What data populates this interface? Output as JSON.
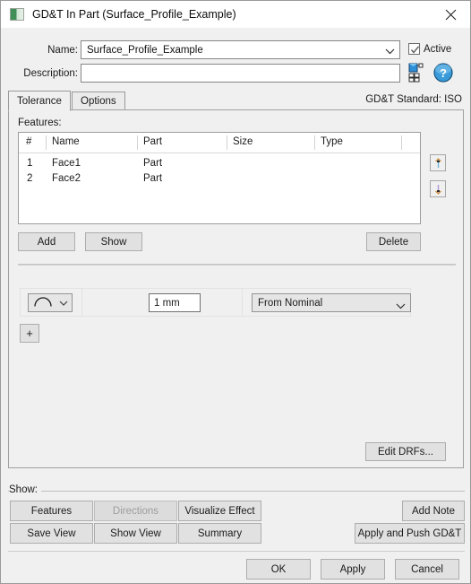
{
  "window": {
    "title": "GD&T In Part (Surface_Profile_Example)",
    "icon": "app-icon",
    "close_icon": "close-icon"
  },
  "form": {
    "name_label": "Name:",
    "name_value": "Surface_Profile_Example",
    "description_label": "Description:",
    "description_value": "",
    "description_placeholder": "",
    "active_label": "Active",
    "active_checked": true,
    "attributes_icon": "attributes-icon",
    "help_icon": "help-icon"
  },
  "tabs": {
    "items": [
      {
        "label": "Tolerance",
        "active": true
      },
      {
        "label": "Options",
        "active": false
      }
    ],
    "standard_label": "GD&T Standard: ISO"
  },
  "features": {
    "section_label": "Features:",
    "columns": [
      "#",
      "Name",
      "Part",
      "Size",
      "Type"
    ],
    "rows": [
      {
        "index": "1",
        "name": "Face1",
        "part": "Part",
        "size": "",
        "type": ""
      },
      {
        "index": "2",
        "name": "Face2",
        "part": "Part",
        "size": "",
        "type": ""
      }
    ],
    "move_up_icon": "arrow-up-icon",
    "move_down_icon": "arrow-down-icon",
    "add_label": "Add",
    "show_label": "Show",
    "delete_label": "Delete"
  },
  "tolerance_row": {
    "symbol_icon": "surface-profile-symbol",
    "symbol_dropdown_icon": "chevron-down-icon",
    "value": "1 mm",
    "mode": "From Nominal",
    "mode_dropdown_icon": "chevron-down-icon",
    "add_row_label": "+",
    "edit_drfs_label": "Edit DRFs..."
  },
  "show_group": {
    "label": "Show:",
    "buttons": [
      {
        "label": "Features",
        "disabled": false
      },
      {
        "label": "Directions",
        "disabled": true
      },
      {
        "label": "Visualize Effect",
        "disabled": false
      },
      {
        "label": "Add Note",
        "disabled": false
      },
      {
        "label": "Save View",
        "disabled": false
      },
      {
        "label": "Show View",
        "disabled": false
      },
      {
        "label": "Summary",
        "disabled": false
      },
      {
        "label": "Apply and Push GD&T",
        "disabled": false
      }
    ]
  },
  "dialog_buttons": {
    "ok": "OK",
    "apply": "Apply",
    "cancel": "Cancel"
  },
  "colors": {
    "window_background": "#f0f0f0",
    "titlebar": "#ffffff",
    "button_face": "#e1e1e1",
    "field_background": "#ffffff",
    "border": "#a0a0a0",
    "disabled_text": "#9d9d9d"
  }
}
